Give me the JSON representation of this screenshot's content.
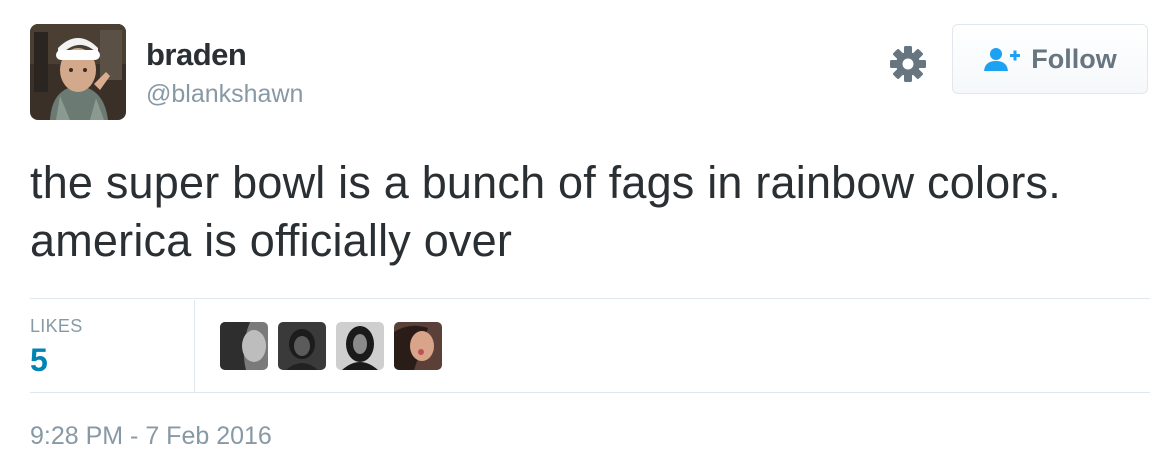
{
  "user": {
    "name": "braden",
    "handle": "@blankshawn"
  },
  "actions": {
    "follow_label": "Follow",
    "settings_icon": "gear-icon",
    "follow_icon": "add-user-icon"
  },
  "tweet": {
    "text": "the super bowl is a bunch of fags in rainbow colors. america is officially over"
  },
  "stats": {
    "likes_label": "LIKES",
    "likes_count": "5"
  },
  "timestamp": "9:28 PM - 7 Feb 2016",
  "colors": {
    "text": "#292f33",
    "muted": "#8899a6",
    "link_blue": "#0084b4",
    "follow_icon_blue": "#1da1f2",
    "divider": "#e1e8ed"
  }
}
